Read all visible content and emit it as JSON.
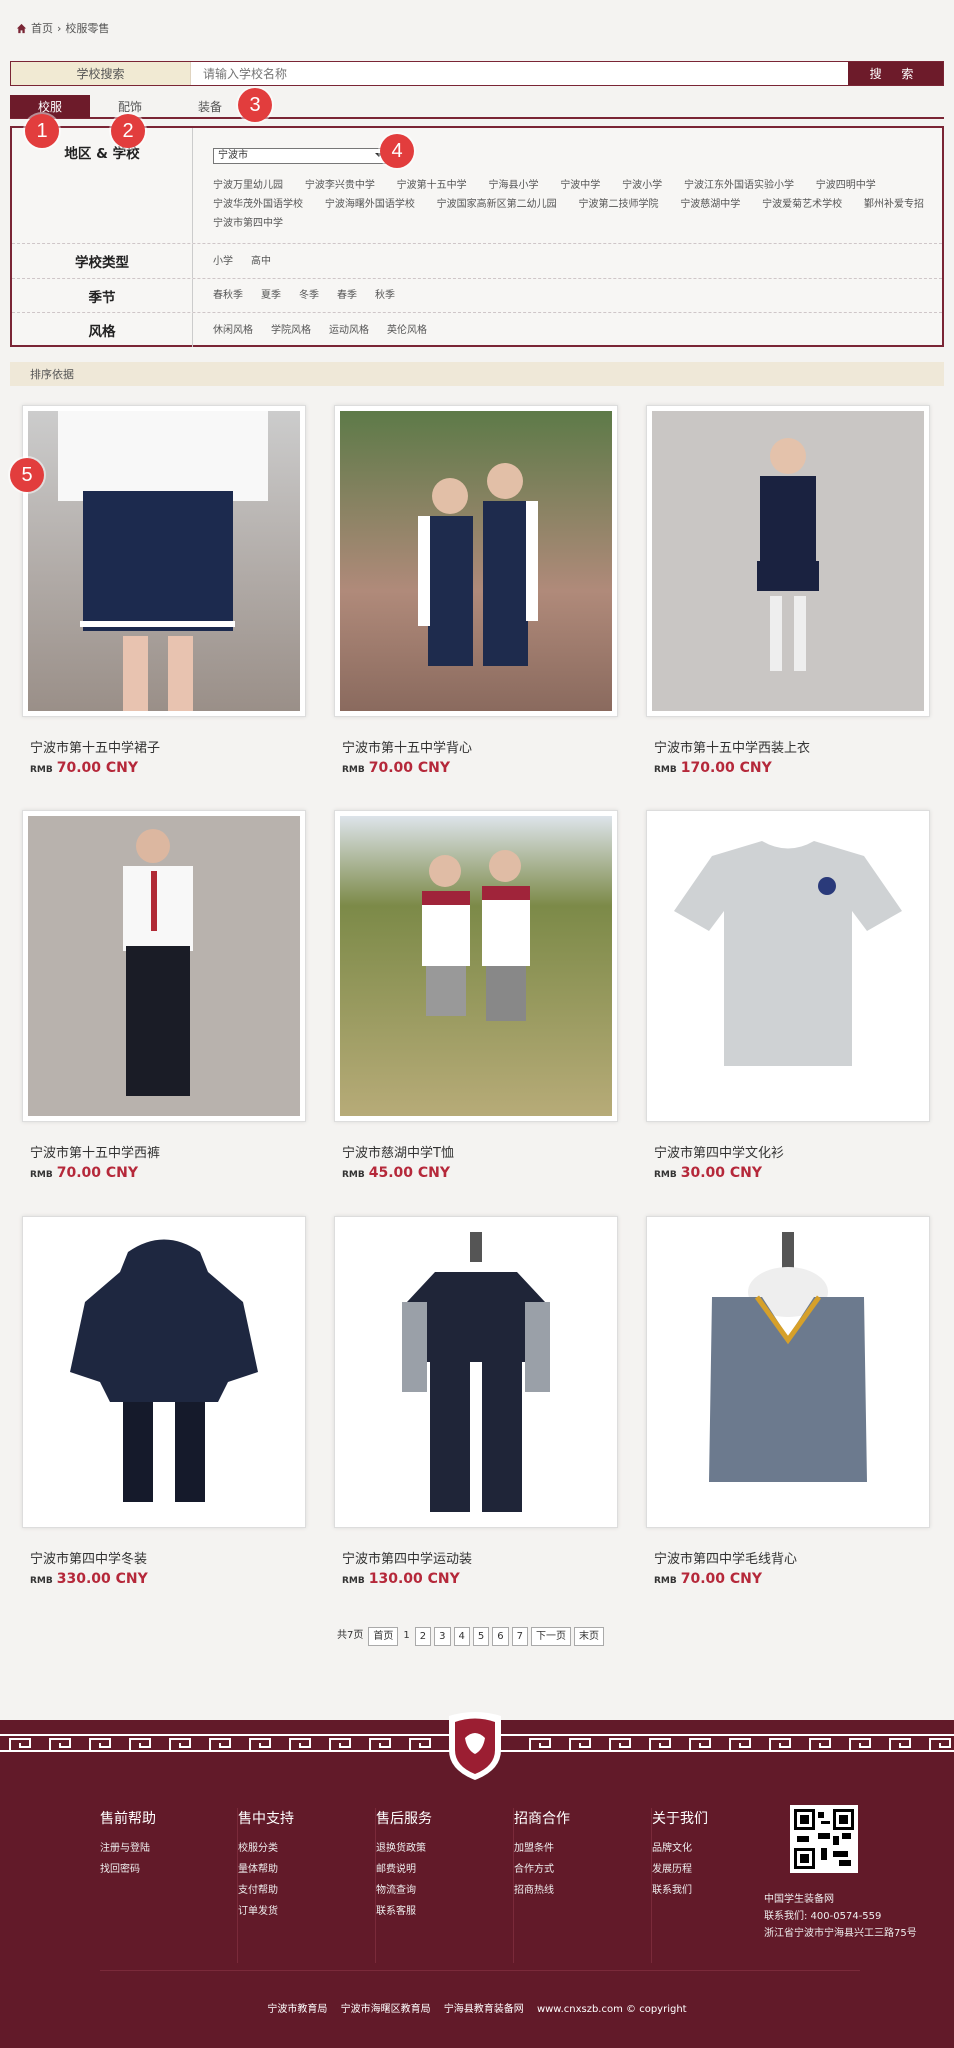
{
  "breadcrumb": {
    "home": "首页",
    "separator": "›",
    "current": "校服零售"
  },
  "search": {
    "label": "学校搜索",
    "placeholder": "请输入学校名称",
    "button": "搜 索"
  },
  "tabs": [
    "校服",
    "配饰",
    "装备"
  ],
  "badges": [
    "1",
    "2",
    "3",
    "4",
    "5"
  ],
  "filter": {
    "region_label": "地区 & 学校",
    "region_selected": "宁波市",
    "schools": [
      "宁波万里幼儿园",
      "宁波李兴贵中学",
      "宁波第十五中学",
      "宁海县小学",
      "宁波中学",
      "宁波小学",
      "宁波江东外国语实验小学",
      "宁波四明中学",
      "宁波华茂外国语学校",
      "宁波海曙外国语学校",
      "宁波国家高新区第二幼儿园",
      "宁波第二技师学院",
      "宁波慈湖中学",
      "宁波爱菊艺术学校",
      "鄞州补爱专招",
      "宁波市第四中学"
    ],
    "type_label": "学校类型",
    "types": [
      "小学",
      "高中"
    ],
    "season_label": "季节",
    "seasons": [
      "春秋季",
      "夏季",
      "冬季",
      "春季",
      "秋季"
    ],
    "style_label": "风格",
    "styles": [
      "休闲风格",
      "学院风格",
      "运动风格",
      "英伦风格"
    ]
  },
  "sort_label": "排序依据",
  "products": [
    {
      "name": "宁波市第十五中学裙子",
      "currency": "RMB",
      "price": "70.00 CNY"
    },
    {
      "name": "宁波市第十五中学背心",
      "currency": "RMB",
      "price": "70.00 CNY"
    },
    {
      "name": "宁波市第十五中学西装上衣",
      "currency": "RMB",
      "price": "170.00 CNY"
    },
    {
      "name": "宁波市第十五中学西裤",
      "currency": "RMB",
      "price": "70.00 CNY"
    },
    {
      "name": "宁波市慈湖中学T恤",
      "currency": "RMB",
      "price": "45.00 CNY"
    },
    {
      "name": "宁波市第四中学文化衫",
      "currency": "RMB",
      "price": "30.00 CNY"
    },
    {
      "name": "宁波市第四中学冬装",
      "currency": "RMB",
      "price": "330.00 CNY"
    },
    {
      "name": "宁波市第四中学运动装",
      "currency": "RMB",
      "price": "130.00 CNY"
    },
    {
      "name": "宁波市第四中学毛线背心",
      "currency": "RMB",
      "price": "70.00 CNY"
    }
  ],
  "pager": {
    "total": "共7页",
    "first": "首页",
    "pages": [
      "1",
      "2",
      "3",
      "4",
      "5",
      "6",
      "7"
    ],
    "next": "下一页",
    "last": "末页"
  },
  "footer": {
    "columns": [
      {
        "title": "售前帮助",
        "links": [
          "注册与登陆",
          "找回密码"
        ]
      },
      {
        "title": "售中支持",
        "links": [
          "校服分类",
          "量体帮助",
          "支付帮助",
          "订单发货"
        ]
      },
      {
        "title": "售后服务",
        "links": [
          "退换货政策",
          "邮费说明",
          "物流查询",
          "联系客服"
        ]
      },
      {
        "title": "招商合作",
        "links": [
          "加盟条件",
          "合作方式",
          "招商热线"
        ]
      },
      {
        "title": "关于我们",
        "links": [
          "品牌文化",
          "发展历程",
          "联系我们"
        ]
      }
    ],
    "contact": [
      "中国学生装备网",
      "联系我们: 400-0574-559",
      "浙江省宁波市宁海县兴工三路75号"
    ],
    "bottom_links": [
      "宁波市教育局",
      "宁波市海曙区教育局",
      "宁海县教育装备网",
      "www.cnxszb.com © copyright"
    ]
  },
  "colors": {
    "brand": "#6d1b2a",
    "price": "#b5283a",
    "badge": "#e23d3d",
    "footer": "#621a29"
  }
}
